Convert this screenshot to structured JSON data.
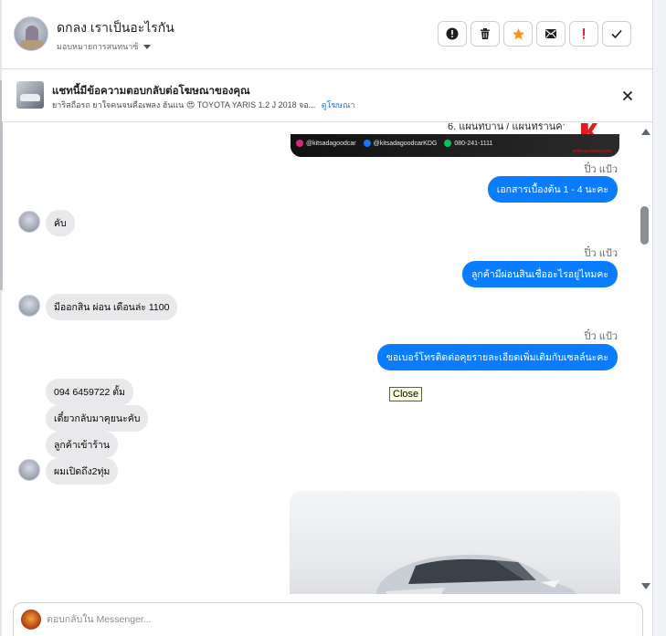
{
  "header": {
    "name": "ดกลง เราเป็นอะไรกัน",
    "assign_label": "มอบหมายการสนทนาซ้",
    "actions": [
      {
        "name": "alert-icon"
      },
      {
        "name": "trash-icon"
      },
      {
        "name": "star-icon",
        "color": "#f7931e"
      },
      {
        "name": "mark-unread-icon"
      },
      {
        "name": "spam-icon",
        "color": "#e41e3f"
      },
      {
        "name": "check-icon"
      }
    ]
  },
  "banner": {
    "title": "แชทนี้มีข้อความตอบกลับต่อโฆษณาของคุณ",
    "description": "ยาริสถือรถ ยาใจคนจนคือเพลง ฮันแน 😍 TOYOTA YARIS 1.2 J 2018 จอ...",
    "link": "ดูโฆษณา"
  },
  "ad_image": {
    "text": "6. แผนที่บ้าน / แผนที่ร้านค้า",
    "contacts": [
      "@kitsadagoodcar",
      "@kitsadagoodcarKDG",
      "080-241-1111"
    ],
    "brand": "KITSADAGOODCAR"
  },
  "messages": {
    "sender_1": "ปิ๋ว แป้ว",
    "out_1": "เอกสารเบื้องต้น 1 - 4  นะคะ",
    "in_1": "คับ",
    "sender_2": "ปิ๋ว แป้ว",
    "out_2": "ลูกค้ามีผ่อนสินเชื่ออะไรอยู่ไหมคะ",
    "in_2": "มีออกสิน ผ่อน เดือนล่ะ 1100",
    "sender_3": "ปิ๋ว แป้ว",
    "out_3": "ขอเบอร์โทรติดต่อคุยรายละเอียดเพิ่มเติมกับเซลล์นะคะ",
    "in_3": "094 6459722 ตั้ม",
    "in_4": "เดี๋ยวกลับมาคุยนะคับ",
    "in_5": "ลูกค้าเข้าร้าน",
    "in_6": "ผมเปิดถึง2ทุ่ม"
  },
  "tooltip": {
    "text": "Close"
  },
  "composer": {
    "placeholder": "ตอบกลับใน Messenger..."
  },
  "colors": {
    "accent": "#0a7cff",
    "incoming_bubble": "#e9e9eb"
  }
}
